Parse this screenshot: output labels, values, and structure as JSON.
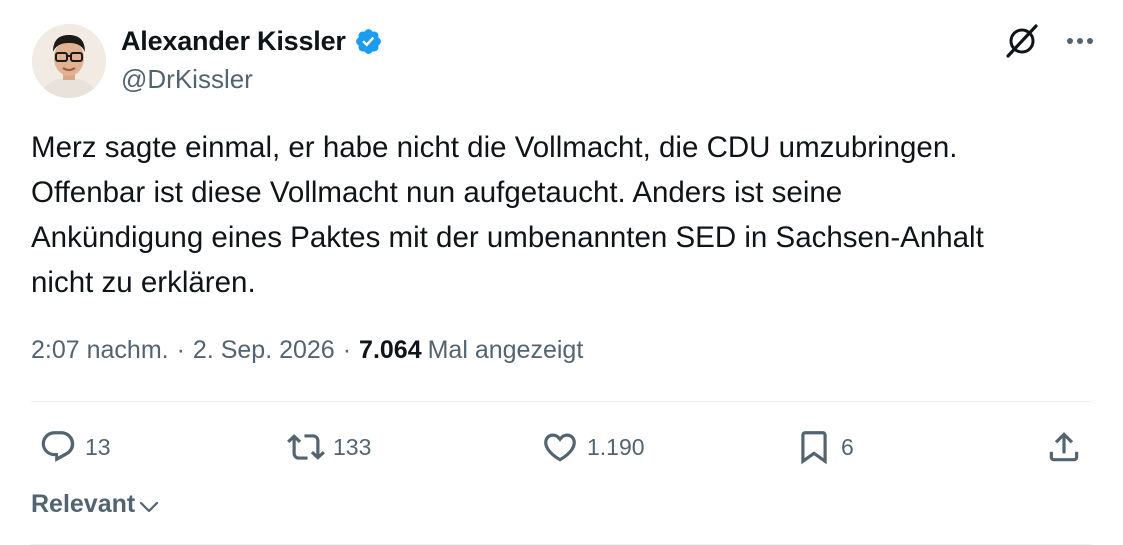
{
  "author": {
    "name": "Alexander Kissler",
    "handle": "@DrKissler",
    "verified": true,
    "avatar": "profile-photo"
  },
  "tweet": {
    "text": "Merz sagte einmal, er habe nicht die Vollmacht, die CDU umzubringen.\nOffenbar ist diese Vollmacht nun aufgetaucht. Anders ist seine\nAnkündigung eines Paktes mit der umbenannten SED in Sachsen-Anhalt\nnicht zu erklären.",
    "time": "2:07 nachm.",
    "date": "2. Sep. 2026",
    "views_count": "7.064",
    "views_label": "Mal angezeigt",
    "separator": "·"
  },
  "actions": {
    "replies": "13",
    "reposts": "133",
    "likes": "1.190",
    "bookmarks": "6"
  },
  "sort": {
    "label": "Relevant"
  },
  "colors": {
    "verified": "#1d9bf0",
    "secondary_text": "#536471",
    "primary_text": "#0f1419",
    "divider": "#eff3f4"
  },
  "icons": [
    "grok-icon",
    "more-icon",
    "reply-icon",
    "repost-icon",
    "like-icon",
    "bookmark-icon",
    "share-icon",
    "chevron-down-icon",
    "verified-badge-icon"
  ]
}
